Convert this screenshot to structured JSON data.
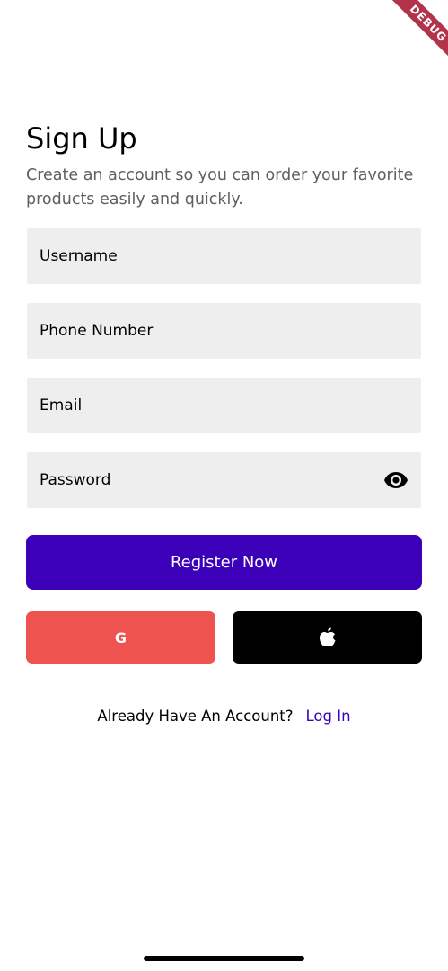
{
  "debug_banner": "DEBUG",
  "header": {
    "title": "Sign Up",
    "subtitle": "Create an account so you can order your favorite products easily and quickly."
  },
  "form": {
    "username_placeholder": "Username",
    "phone_placeholder": "Phone Number",
    "email_placeholder": "Email",
    "password_placeholder": "Password",
    "password_toggle_icon": "eye-icon"
  },
  "actions": {
    "register_label": "Register Now",
    "google_label": "G",
    "apple_icon": "apple-icon"
  },
  "footer": {
    "prompt": "Already Have An Account?",
    "login_label": "Log In"
  },
  "colors": {
    "primary": "#3c00b8",
    "google": "#ef5350",
    "apple": "#000000",
    "field_background": "#eeeeee",
    "subtitle_text": "#5f5f5f"
  }
}
